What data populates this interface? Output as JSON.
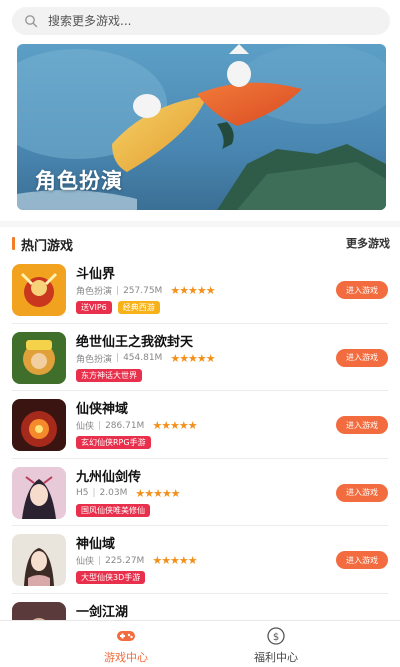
{
  "search": {
    "placeholder": "搜索更多游戏..."
  },
  "banner": {
    "title": "角色扮演"
  },
  "section": {
    "title": "热门游戏",
    "more": "更多游戏"
  },
  "games": [
    {
      "name": "斗仙界",
      "category": "角色扮演",
      "size": "257.75M",
      "stars": "★★★★★",
      "tags": [
        "送VIP6",
        "经典西游"
      ],
      "button": "进入游戏"
    },
    {
      "name": "绝世仙王之我欲封天",
      "category": "角色扮演",
      "size": "454.81M",
      "stars": "★★★★★",
      "tags": [
        "东方神话大世界"
      ],
      "button": "进入游戏"
    },
    {
      "name": "仙侠神域",
      "category": "仙侠",
      "size": "286.71M",
      "stars": "★★★★★",
      "tags": [
        "玄幻仙侠RPG手游"
      ],
      "button": "进入游戏"
    },
    {
      "name": "九州仙剑传",
      "category": "H5",
      "size": "2.03M",
      "stars": "★★★★★",
      "tags": [
        "国风仙侠唯美修仙"
      ],
      "button": "进入游戏"
    },
    {
      "name": "神仙域",
      "category": "仙侠",
      "size": "225.27M",
      "stars": "★★★★★",
      "tags": [
        "大型仙侠3D手游"
      ],
      "button": "进入游戏"
    },
    {
      "name": "一剑江湖",
      "category": "",
      "size": "",
      "stars": "",
      "tags": [],
      "button": ""
    }
  ],
  "nav": {
    "game_center": "游戏中心",
    "welfare_center": "福利中心"
  },
  "colors": {
    "accent": "#f26c3f",
    "star": "#f39019",
    "tag_red": "#e8304c",
    "tag_gold": "#f7b21a"
  },
  "icons": {
    "search": "search-icon",
    "game": "gamepad-icon",
    "welfare": "coin-icon"
  }
}
